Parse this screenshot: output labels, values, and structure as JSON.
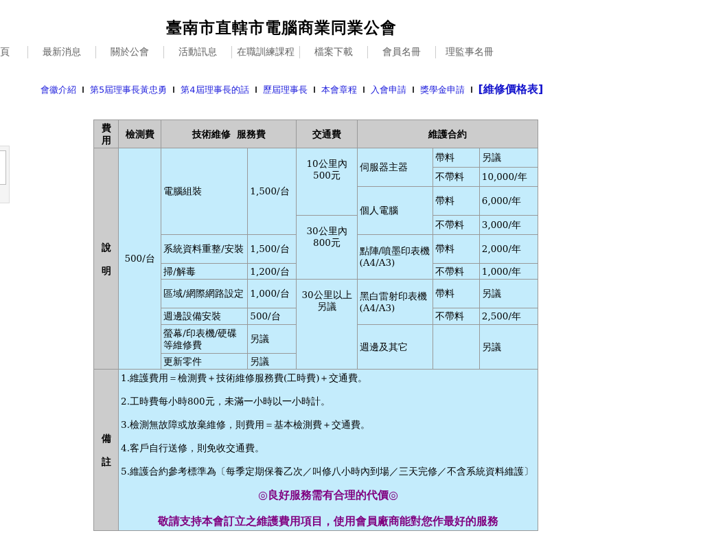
{
  "site_title": "臺南市直轄市電腦商業同業公會",
  "main_nav": [
    "頁",
    "最新消息",
    "關於公會",
    "活動訊息",
    "在職訓練課程",
    "檔案下載",
    "會員名冊",
    "理監事名冊"
  ],
  "sub_nav": [
    {
      "label": "會徽介紹",
      "selected": false
    },
    {
      "label": "第5屆理事長黃忠勇",
      "selected": false
    },
    {
      "label": "第4屆理事長的話",
      "selected": false
    },
    {
      "label": "歷屆理事長",
      "selected": false
    },
    {
      "label": "本會章程",
      "selected": false
    },
    {
      "label": "入會申請",
      "selected": false
    },
    {
      "label": "獎學金申請",
      "selected": false
    },
    {
      "label": "[維修價格表]",
      "selected": true
    }
  ],
  "table": {
    "headers": [
      "費用",
      "檢測費",
      "技術維修  服務費",
      "交通費",
      "維護合約"
    ],
    "section_label": "說明",
    "inspection_fee": "500/台",
    "services": [
      {
        "name": "電腦組裝",
        "fee": "1,500/台"
      },
      {
        "name": "系統資料重整/安裝",
        "fee": "1,500/台"
      },
      {
        "name": "掃/解毒",
        "fee": "1,200/台"
      },
      {
        "name": "區域/網際網路設定",
        "fee": "1,000/台"
      },
      {
        "name": "週邊設備安裝",
        "fee": "500/台"
      },
      {
        "name": "螢幕/印表機/硬碟等維修費",
        "fee": "另議"
      },
      {
        "name": "更新零件",
        "fee": "另議"
      }
    ],
    "transport": [
      "10公里內500元",
      "30公里內800元",
      "30公里以上另議"
    ],
    "contracts": [
      {
        "item": "伺服器主器",
        "options": [
          {
            "type": "帶料",
            "price": "另議"
          },
          {
            "type": "不帶料",
            "price": "10,000/年"
          }
        ]
      },
      {
        "item": "個人電腦",
        "options": [
          {
            "type": "帶料",
            "price": "6,000/年"
          },
          {
            "type": "不帶料",
            "price": "3,000/年"
          }
        ]
      },
      {
        "item": "點陣/噴墨印表機(A4/A3)",
        "options": [
          {
            "type": "帶料",
            "price": "2,000/年"
          },
          {
            "type": "不帶料",
            "price": "1,000/年"
          }
        ]
      },
      {
        "item": "黑白雷射印表機(A4/A3)",
        "options": [
          {
            "type": "帶料",
            "price": "另議"
          },
          {
            "type": "不帶料",
            "price": "2,500/年"
          }
        ]
      },
      {
        "item": "週邊及其它",
        "options": [
          {
            "price": "另議"
          }
        ]
      }
    ],
    "notes_label": "備註",
    "notes": [
      "1.維護費用＝檢測費＋技術維修服務費(工時費)＋交通費。",
      "2.工時費每小時800元，未滿一小時以一小時計。",
      "3.檢測無故障或放棄維修，則費用＝基本檢測費＋交通費。",
      "4.客戶自行送修，則免收交通費。",
      "5.維護合約參考標準為〔每季定期保養乙次／叫修八小時內到場／三天完修／不含系統資料維護〕"
    ],
    "slogans": [
      "◎良好服務需有合理的代價◎",
      "敬請支持本會訂立之維護費用項目，使用會員廠商能對您作最好的服務"
    ]
  }
}
